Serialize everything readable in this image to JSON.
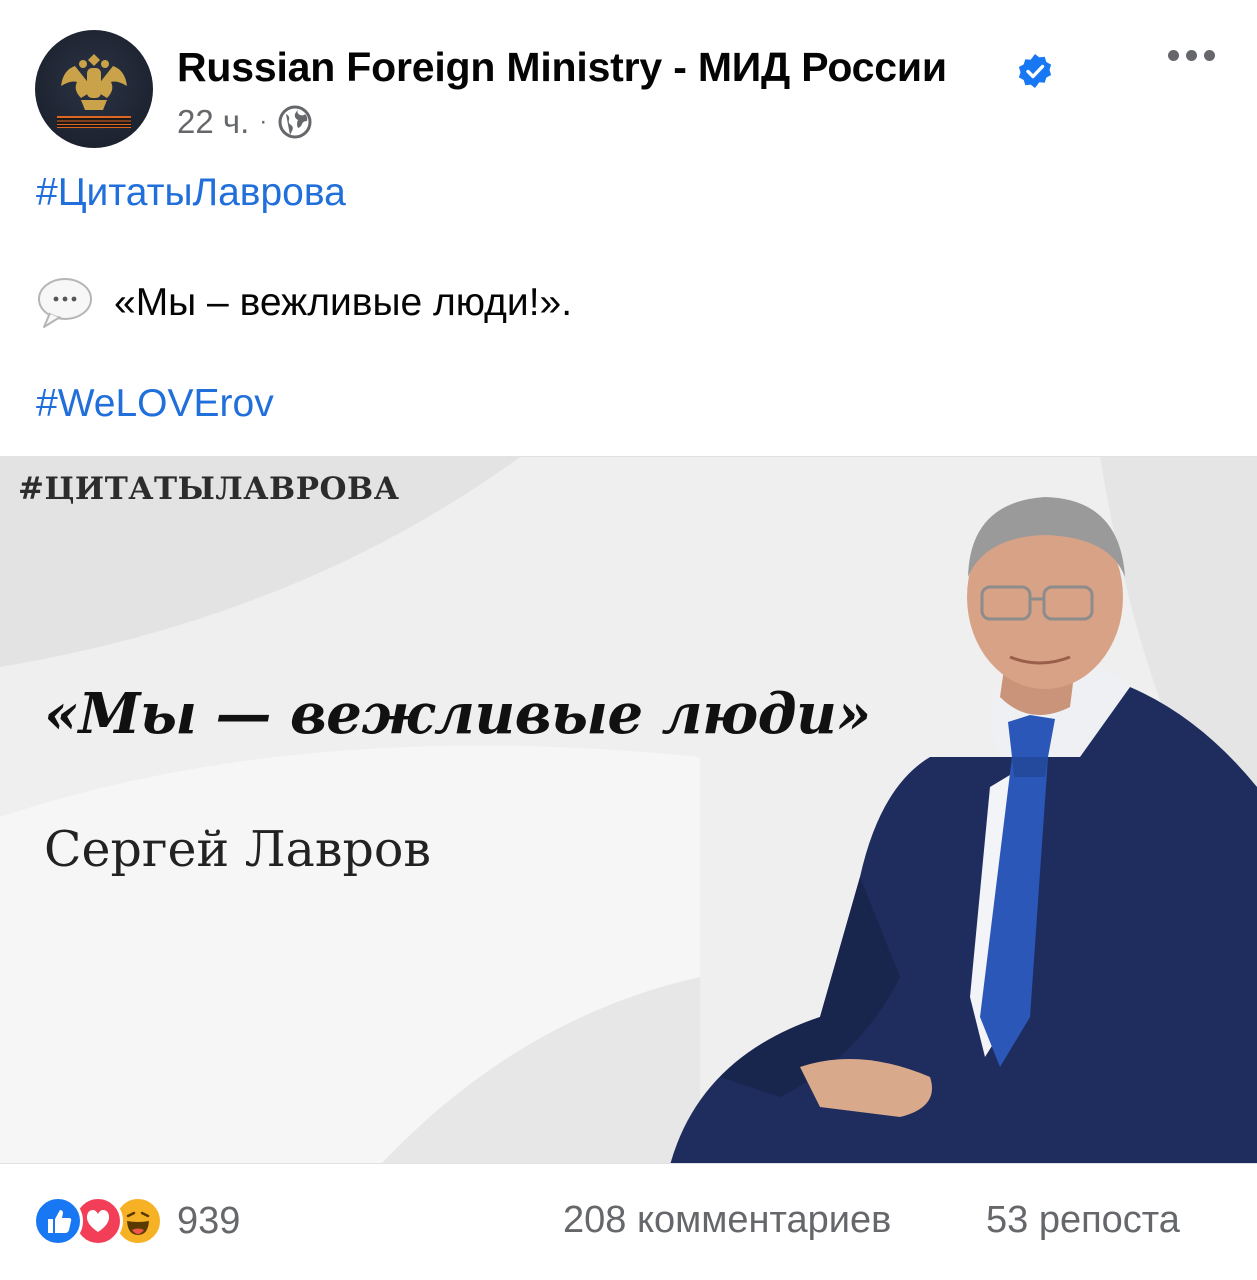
{
  "header": {
    "page_name": "Russian Foreign Ministry - МИД России",
    "time": "22 ч.",
    "separator": "·",
    "privacy_icon": "globe-icon",
    "verified_icon": "verified-badge-icon",
    "more_icon": "more-options-icon"
  },
  "post": {
    "hashtag_1": "#ЦитатыЛаврова",
    "quote_icon": "speech-bubble-icon",
    "quote": "«Мы – вежливые люди!».",
    "hashtag_2": "#WeLOVErov"
  },
  "image": {
    "hashtag": "#ЦИТАТЫЛАВРОВА",
    "quote": "«Мы — вежливые люди»",
    "author": "Сергей Лавров"
  },
  "footer": {
    "reaction_icons": [
      "like-icon",
      "love-icon",
      "haha-icon"
    ],
    "reactions_count": "939",
    "comments": "208 комментариев",
    "shares": "53 репоста"
  },
  "colors": {
    "link": "#216fdb",
    "secondary_text": "#65676b",
    "verified": "#1877f2",
    "suit": "#1f2d5e"
  }
}
